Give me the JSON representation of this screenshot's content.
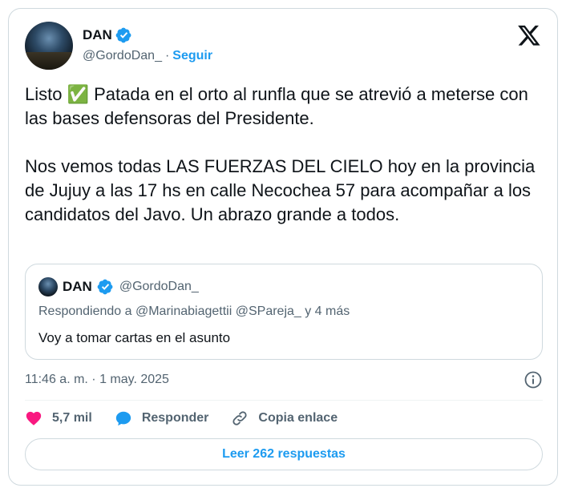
{
  "tweet": {
    "author": {
      "name": "DAN",
      "handle": "@GordoDan_",
      "separator": "·",
      "follow_label": "Seguir"
    },
    "text": "Listo ✅ Patada en el orto al runfla que se atrevió a meterse con las bases defensoras del Presidente.\n\nNos vemos todas LAS FUERZAS DEL CIELO hoy en la provincia de Jujuy a las 17 hs en calle Necochea 57 para acompañar a los candidatos del Javo. Un abrazo grande a todos.",
    "quote": {
      "name": "DAN",
      "handle": "@GordoDan_",
      "replying_to": "Respondiendo a @Marinabiagettii @SPareja_ y 4 más",
      "text": "Voy a tomar cartas en el asunto"
    },
    "timestamp": "11:46 a. m. · 1 may. 2025",
    "actions": {
      "likes_count": "5,7 mil",
      "reply_label": "Responder",
      "copy_link_label": "Copia enlace"
    },
    "read_replies_label": "Leer 262 respuestas"
  },
  "icons": {
    "verified": "verified-badge-icon",
    "platform": "x-logo-icon",
    "info": "info-icon",
    "like": "heart-icon",
    "reply": "speech-bubble-icon",
    "link": "link-icon"
  },
  "colors": {
    "accent": "#1d9bf0",
    "like": "#f91880",
    "text": "#0f1419",
    "secondary": "#536471",
    "border": "#cfd9de"
  }
}
